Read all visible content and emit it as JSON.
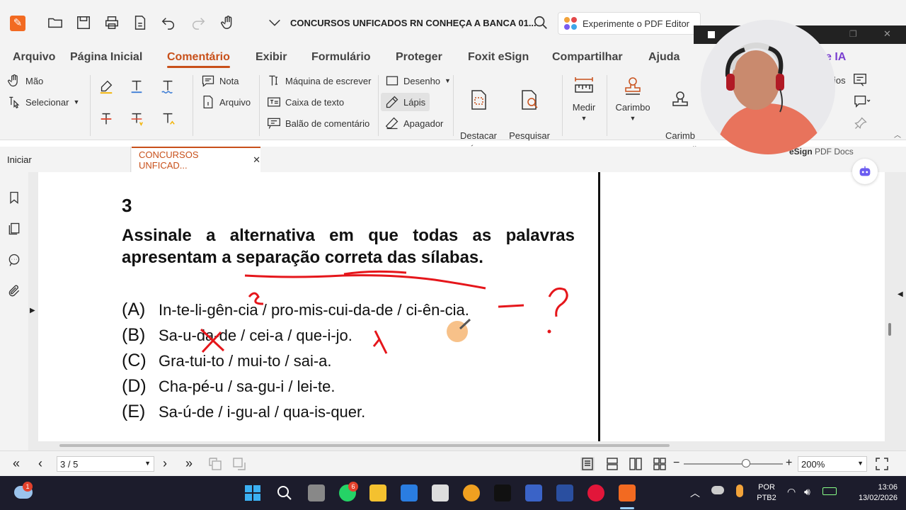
{
  "titlebar": {
    "doc_title": "CONCURSOS UNFICADOS RN  CONHEÇA A BANCA 01...",
    "try_editor": "Experimente o PDF Editor"
  },
  "menu": {
    "tabs": [
      "Arquivo",
      "Página Inicial",
      "Comentário",
      "Exibir",
      "Formulário",
      "Proteger",
      "Foxit eSign",
      "Compartilhar",
      "Ajuda"
    ],
    "active": "Comentário",
    "ai_label": "e IA"
  },
  "toolbar": {
    "hand": "Mão",
    "select": "Selecionar",
    "note": "Nota",
    "file": "Arquivo",
    "typewriter": "Máquina de escrever",
    "textbox": "Caixa de texto",
    "callout": "Balão de comentário",
    "drawing": "Desenho",
    "pencil": "Lápis",
    "eraser": "Apagador",
    "highlight_area": "Destacar\nÁrea",
    "search_highlight": "Pesquisar\n& Destaque",
    "measure": "Medir",
    "stamp": "Carimbo",
    "custom_stamp": "Carimb\nPersonalizad",
    "partial_ios": "ios"
  },
  "doctabs": {
    "start": "Iniciar",
    "current": "CONCURSOS UNFICAD...",
    "esign": "eSign",
    "pdf_docs": "PDF Docs"
  },
  "question": {
    "number": "3",
    "text_line1": "Assinale a alternativa em que todas as palavras",
    "text_line2": "apresentam a separação correta das sílabas.",
    "options": [
      {
        "letter": "(A)",
        "text": "In-te-li-gên-cia / pro-mis-cui-da-de / ci-ên-cia."
      },
      {
        "letter": "(B)",
        "text": "Sa-u-da-de / cei-a / que-i-jo."
      },
      {
        "letter": "(C)",
        "text": "Gra-tui-to / mui-to / sai-a."
      },
      {
        "letter": "(D)",
        "text": "Cha-pé-u / sa-gu-i / lei-te."
      },
      {
        "letter": "(E)",
        "text": "Sa-ú-de / i-gu-al / qua-is-quer."
      }
    ]
  },
  "statusbar": {
    "page": "3 / 5",
    "zoom": "200%",
    "zoom_level_fraction": 0.63
  },
  "taskbar": {
    "weather_badge": "1",
    "whatsapp_badge": "6",
    "lang_line1": "POR",
    "lang_line2": "PTB2",
    "time": "13:06",
    "date": "13/02/2026"
  },
  "colors": {
    "accent": "#c8501a",
    "ink": "#e5161b",
    "taskbar": "#1c1c2c"
  }
}
